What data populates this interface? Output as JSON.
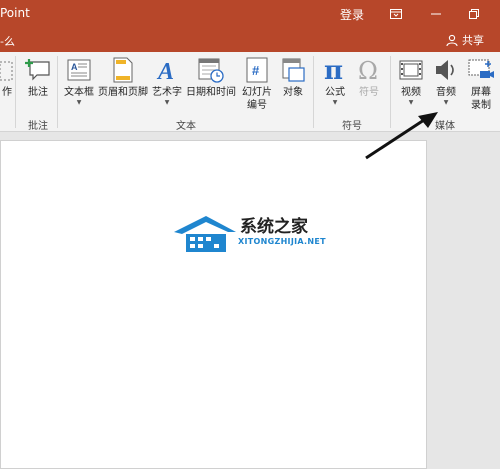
{
  "titlebar": {
    "app_title": "Point",
    "login": "登录",
    "color": "#b7472a"
  },
  "tellbar": {
    "tell_text": "-么",
    "share": "共享"
  },
  "ribbon": {
    "groups": {
      "comments": "批注",
      "text": "文本",
      "symbols": "符号",
      "media": "媒体"
    },
    "buttons": {
      "prev_label": "作",
      "comment": "批注",
      "textbox": "文本框",
      "header_footer": "页眉和页脚",
      "wordart": "艺术字",
      "datetime": "日期和时间",
      "slide_number_1": "幻灯片",
      "slide_number_2": "编号",
      "object": "对象",
      "equation": "公式",
      "symbol": "符号",
      "video": "视频",
      "audio": "音频",
      "screen_rec_1": "屏幕",
      "screen_rec_2": "录制"
    },
    "icon_glyphs": {
      "wordart": "A",
      "equation": "π",
      "symbol": "Ω",
      "slide_number": "#"
    }
  },
  "watermark": {
    "title": "系统之家",
    "subtitle": "XITONGZHIJIA.NET"
  }
}
